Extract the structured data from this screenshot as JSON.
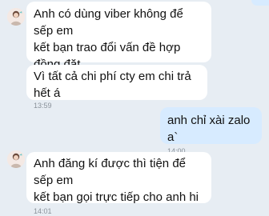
{
  "messages": [
    {
      "direction": "incoming",
      "text": "Anh có dùng viber không để sếp em\nkết bạn trao đổi vấn đề hợp đồng đặt\ncọc",
      "time": ""
    },
    {
      "direction": "incoming",
      "text": "Vì tất cả chi phí cty em chi trả hết á",
      "time": "13:59"
    },
    {
      "direction": "outgoing",
      "text": "anh chỉ xài zalo a`",
      "time": "14:00"
    },
    {
      "direction": "incoming",
      "text": "Anh đăng kí được thì tiện để sếp em\nkết bạn gọi trực tiếp cho anh hi",
      "time": "14:01"
    }
  ],
  "avatar_icon": "contact-avatar-icon",
  "colors": {
    "background": "#e7edf3",
    "incoming_bubble": "#ffffff",
    "outgoing_bubble": "#d7ebff",
    "timestamp": "#8a929a"
  }
}
